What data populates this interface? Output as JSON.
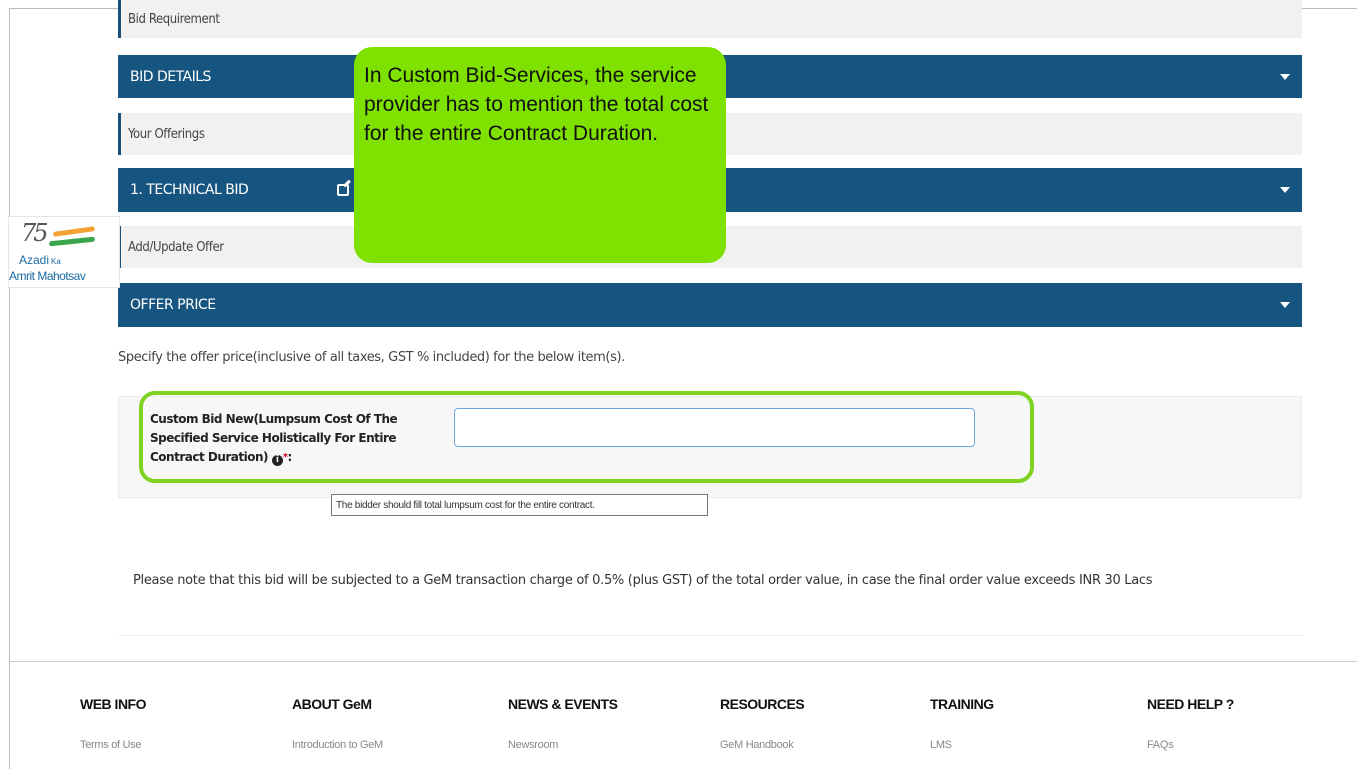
{
  "sections": {
    "bid_requirement": "Bid Requirement",
    "bid_details": "BID DETAILS",
    "your_offerings": "Your Offerings",
    "technical_bid": "1. TECHNICAL BID",
    "add_update_offer": "Add/Update Offer",
    "offer_price": "OFFER PRICE"
  },
  "logo": {
    "number": "75",
    "line1": "Azadi",
    "line1_small": "Ka",
    "line2": "Amrit Mahotsav"
  },
  "callout": {
    "text": "In Custom Bid-Services, the service provider has to mention the total cost for the entire Contract Duration."
  },
  "offer": {
    "instruction": "Specify the offer price(inclusive of all taxes, GST % included) for the below item(s).",
    "field_label": "Custom Bid New(Lumpsum Cost Of The Specified Service Holistically For Entire Contract Duration)",
    "field_value": "",
    "required_marker": "*",
    "colon": ":",
    "info_icon_glyph": "i",
    "tooltip": "The bidder should fill total lumpsum cost for the entire contract."
  },
  "note": "Please note that this bid will be subjected to a GeM transaction charge of 0.5% (plus GST) of the total order value, in case the final order value exceeds INR 30 Lacs",
  "footer": {
    "columns": [
      {
        "heading": "WEB INFO",
        "link": "Terms of Use"
      },
      {
        "heading": "ABOUT GeM",
        "link": "Introduction to GeM"
      },
      {
        "heading": "NEWS & EVENTS",
        "link": "Newsroom"
      },
      {
        "heading": "RESOURCES",
        "link": "GeM Handbook"
      },
      {
        "heading": "TRAINING",
        "link": "LMS"
      },
      {
        "heading": "NEED HELP ?",
        "link": "FAQs"
      }
    ]
  },
  "colors": {
    "section_bar": "#175581",
    "callout_bg": "#7fe100",
    "highlight_border": "#7ed321"
  },
  "icons": {
    "caret": "chevron-down-icon",
    "edit": "edit-icon",
    "info": "info-icon"
  }
}
